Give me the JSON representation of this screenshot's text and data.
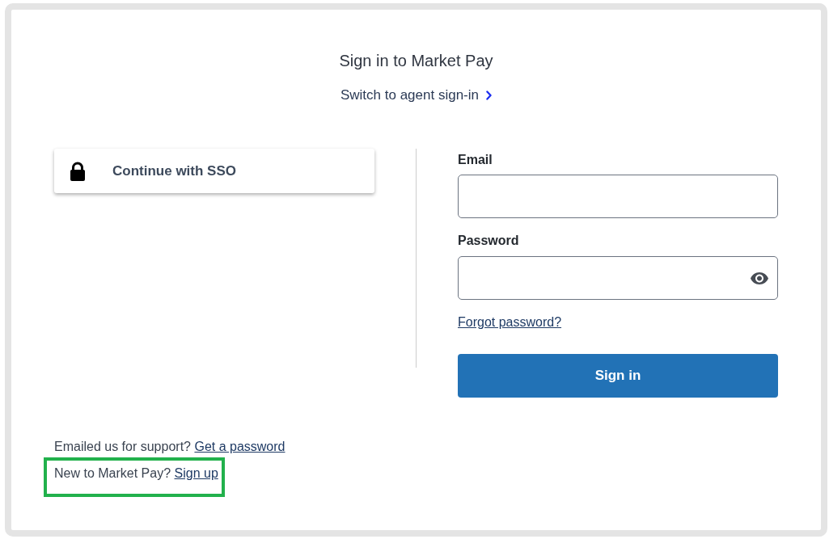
{
  "header": {
    "title": "Sign in to Market Pay",
    "switch_link": "Switch to agent sign-in"
  },
  "sso_button": {
    "label": "Continue with SSO"
  },
  "form": {
    "fields": [
      {
        "label": "Email",
        "kind": "email"
      },
      {
        "label": "Password",
        "kind": "password"
      }
    ],
    "forgot_link": "Forgot password?",
    "submit_button": "Sign in"
  },
  "footer": [
    {
      "text": "Emailed us for support?",
      "link": "Get a password",
      "highlighted": false
    },
    {
      "text": "New to Market Pay?",
      "link": "Sign up",
      "highlighted": true
    }
  ]
}
